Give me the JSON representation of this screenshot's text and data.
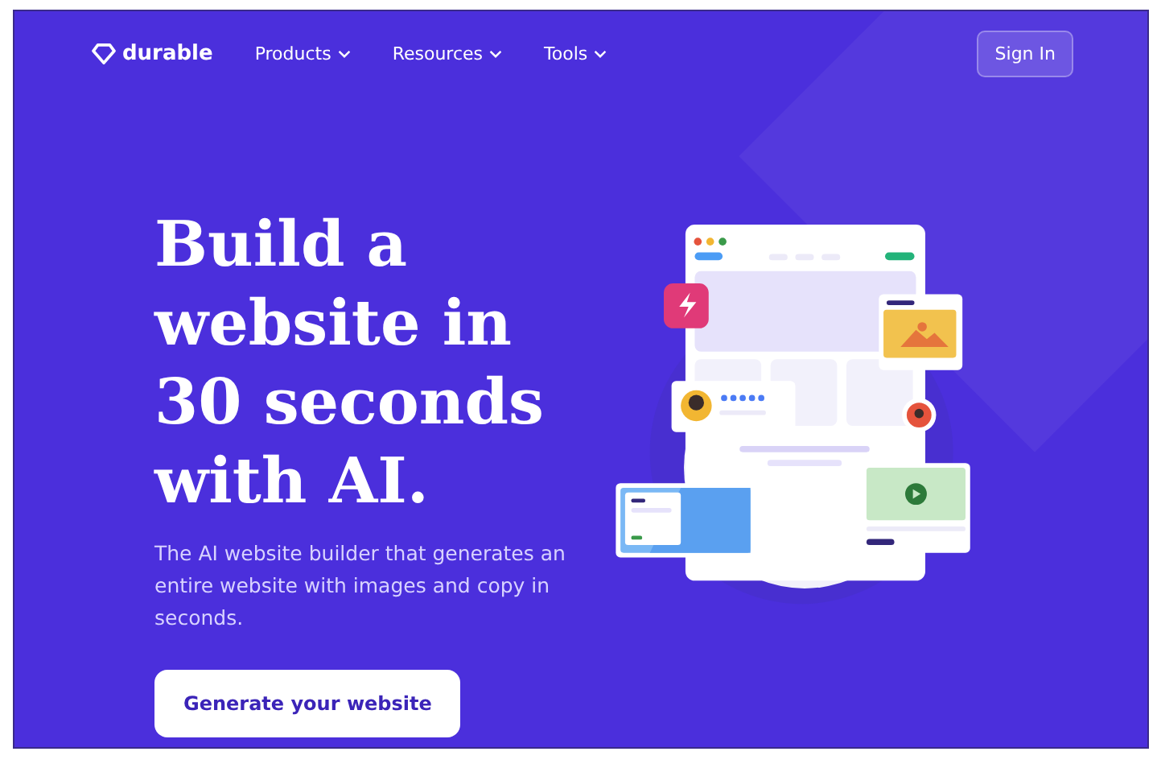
{
  "brand": {
    "name": "durable"
  },
  "nav": [
    {
      "label": "Products"
    },
    {
      "label": "Resources"
    },
    {
      "label": "Tools"
    }
  ],
  "sign_in": {
    "label": "Sign In"
  },
  "hero": {
    "title_lines": [
      "Build a",
      "website in",
      "30 seconds",
      "with AI."
    ],
    "subtitle": "The AI website builder that generates an entire website with images and copy in seconds.",
    "cta": "Generate your website"
  }
}
